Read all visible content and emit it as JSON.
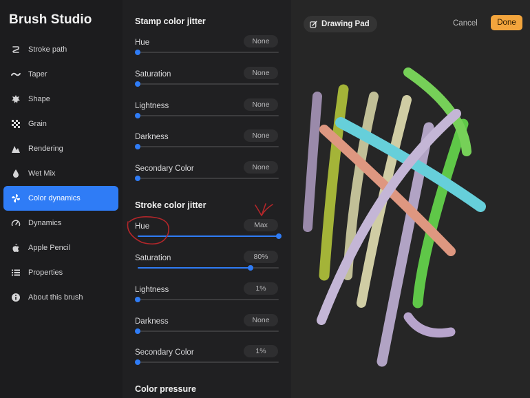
{
  "app": {
    "title": "Brush Studio"
  },
  "sidebar": {
    "items": [
      {
        "label": "Stroke path",
        "icon": "stroke-path-icon",
        "active": false
      },
      {
        "label": "Taper",
        "icon": "taper-icon",
        "active": false
      },
      {
        "label": "Shape",
        "icon": "shape-icon",
        "active": false
      },
      {
        "label": "Grain",
        "icon": "grain-icon",
        "active": false
      },
      {
        "label": "Rendering",
        "icon": "rendering-icon",
        "active": false
      },
      {
        "label": "Wet Mix",
        "icon": "wet-mix-icon",
        "active": false
      },
      {
        "label": "Color dynamics",
        "icon": "color-dynamics-icon",
        "active": true
      },
      {
        "label": "Dynamics",
        "icon": "dynamics-icon",
        "active": false
      },
      {
        "label": "Apple Pencil",
        "icon": "apple-pencil-icon",
        "active": false
      },
      {
        "label": "Properties",
        "icon": "properties-icon",
        "active": false
      },
      {
        "label": "About this brush",
        "icon": "info-icon",
        "active": false
      }
    ]
  },
  "panel": {
    "stamp": {
      "title": "Stamp color jitter",
      "rows": [
        {
          "label": "Hue",
          "value": "None",
          "level": 0
        },
        {
          "label": "Saturation",
          "value": "None",
          "level": 0
        },
        {
          "label": "Lightness",
          "value": "None",
          "level": 0
        },
        {
          "label": "Darkness",
          "value": "None",
          "level": 0
        },
        {
          "label": "Secondary Color",
          "value": "None",
          "level": 0
        }
      ]
    },
    "stroke": {
      "title": "Stroke color jitter",
      "rows": [
        {
          "label": "Hue",
          "value": "Max",
          "level": 1.0
        },
        {
          "label": "Saturation",
          "value": "80%",
          "level": 0.8
        },
        {
          "label": "Lightness",
          "value": "1%",
          "level": 0
        },
        {
          "label": "Darkness",
          "value": "None",
          "level": 0
        },
        {
          "label": "Secondary Color",
          "value": "1%",
          "level": 0
        }
      ]
    },
    "pressure": {
      "title": "Color pressure"
    }
  },
  "pad": {
    "label": "Drawing Pad",
    "cancel_label": "Cancel",
    "done_label": "Done"
  },
  "colors": {
    "accent": "#2f7cf6",
    "done": "#f3a53d",
    "annotation": "#b3262a"
  }
}
